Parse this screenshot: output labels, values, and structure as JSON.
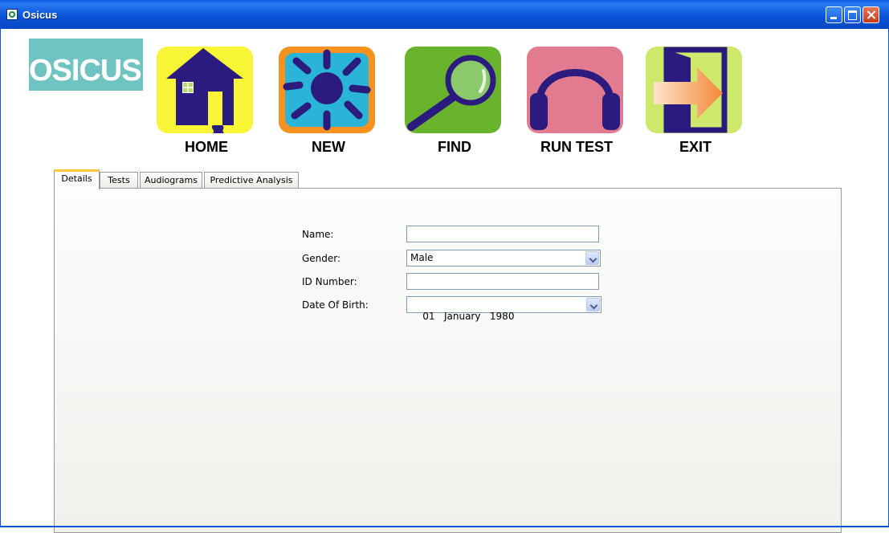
{
  "window": {
    "title": "Osicus"
  },
  "logo": {
    "text": "OSICUS"
  },
  "toolbar": {
    "home_label": "HOME",
    "new_label": "NEW",
    "find_label": "FIND",
    "run_test_label": "RUN TEST",
    "exit_label": "EXIT"
  },
  "tabs": [
    "Details",
    "Tests",
    "Audiograms",
    "Predictive Analysis"
  ],
  "form": {
    "name_label": "Name:",
    "name_value": "",
    "gender_label": "Gender:",
    "gender_value": "Male",
    "id_label": "ID Number:",
    "id_value": "",
    "dob_label": "Date Of Birth:",
    "dob_value": "01   January   1980"
  },
  "colors": {
    "home_tile": "#f7f536",
    "new_tile": "#f7921e",
    "find_tile": "#6ab42d",
    "run_test_tile": "#e27b90",
    "exit_tile": "#cde86a",
    "icon_navy": "#2b1b7e",
    "logo_bg": "#6fc3c1",
    "title_bar": "#0b55d9"
  },
  "icons": {
    "home": "house-icon",
    "new": "sun-icon",
    "find": "magnifier-icon",
    "run_test": "headphones-icon",
    "exit": "door-exit-icon"
  }
}
